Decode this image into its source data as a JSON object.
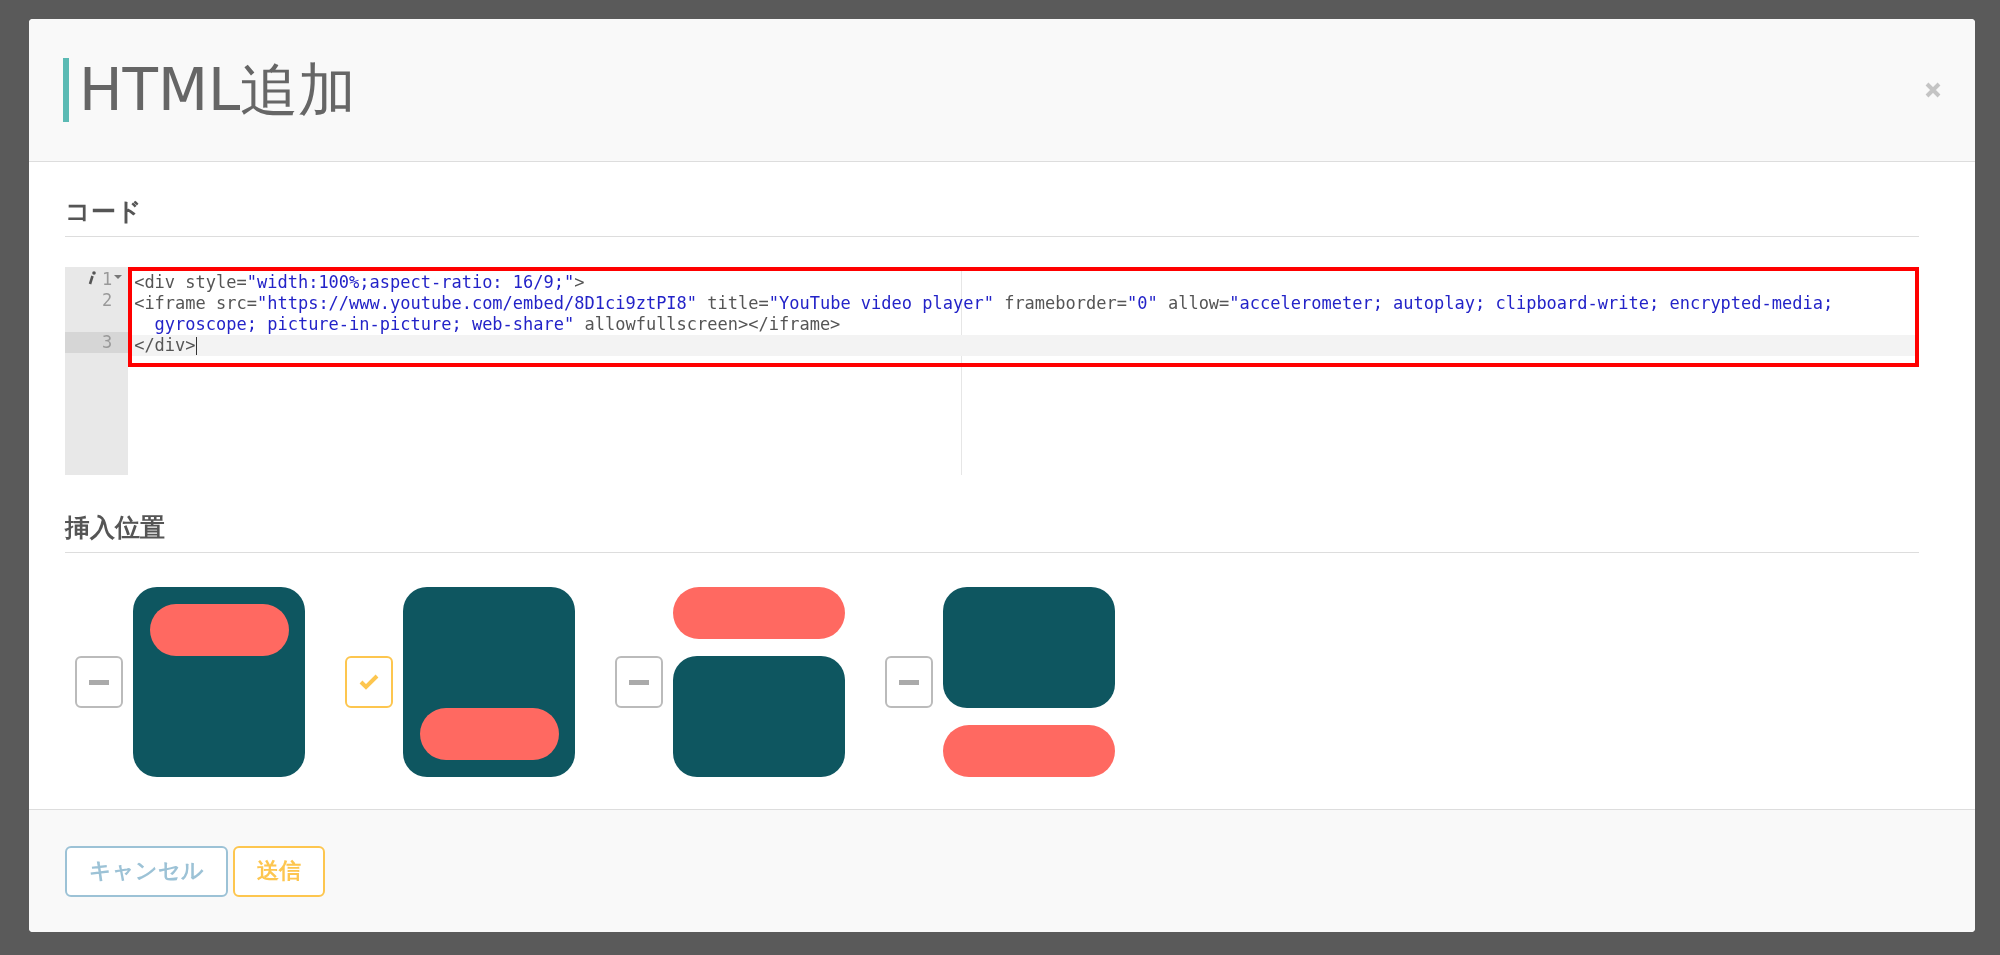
{
  "modal": {
    "title": "HTML追加"
  },
  "code_section": {
    "heading": "コード",
    "lines": [
      {
        "number": "1",
        "active": false,
        "segments": [
          {
            "kind": "tag",
            "text": "<div style="
          },
          {
            "kind": "string",
            "text": "\"width:100%;aspect-ratio: 16/9;\""
          },
          {
            "kind": "tag",
            "text": ">"
          }
        ]
      },
      {
        "number": "2",
        "active": false,
        "segments": [
          {
            "kind": "tag",
            "text": "<iframe src="
          },
          {
            "kind": "string",
            "text": "\"https://www.youtube.com/embed/8D1ci9ztPI8\""
          },
          {
            "kind": "tag",
            "text": " title="
          },
          {
            "kind": "string",
            "text": "\"YouTube video player\""
          },
          {
            "kind": "tag",
            "text": " frameborder="
          },
          {
            "kind": "string",
            "text": "\"0\""
          },
          {
            "kind": "tag",
            "text": " allow="
          },
          {
            "kind": "string",
            "text": "\"accelerometer; autoplay; clipboard-write; encrypted-media; gyroscope; picture-in-picture; web-share\""
          },
          {
            "kind": "tag",
            "text": " allowfullscreen></iframe>"
          }
        ]
      },
      {
        "number": "3",
        "active": true,
        "segments": [
          {
            "kind": "tag",
            "text": "</div>"
          }
        ]
      }
    ]
  },
  "position_section": {
    "heading": "挿入位置",
    "options": [
      {
        "kind": "overlay-top",
        "selected": false
      },
      {
        "kind": "overlay-bottom",
        "selected": true
      },
      {
        "kind": "above",
        "selected": false
      },
      {
        "kind": "below",
        "selected": false
      }
    ]
  },
  "footer": {
    "buttons": [
      {
        "label": "キャンセル",
        "kind": "cancel"
      },
      {
        "label": "送信",
        "kind": "submit"
      }
    ]
  }
}
